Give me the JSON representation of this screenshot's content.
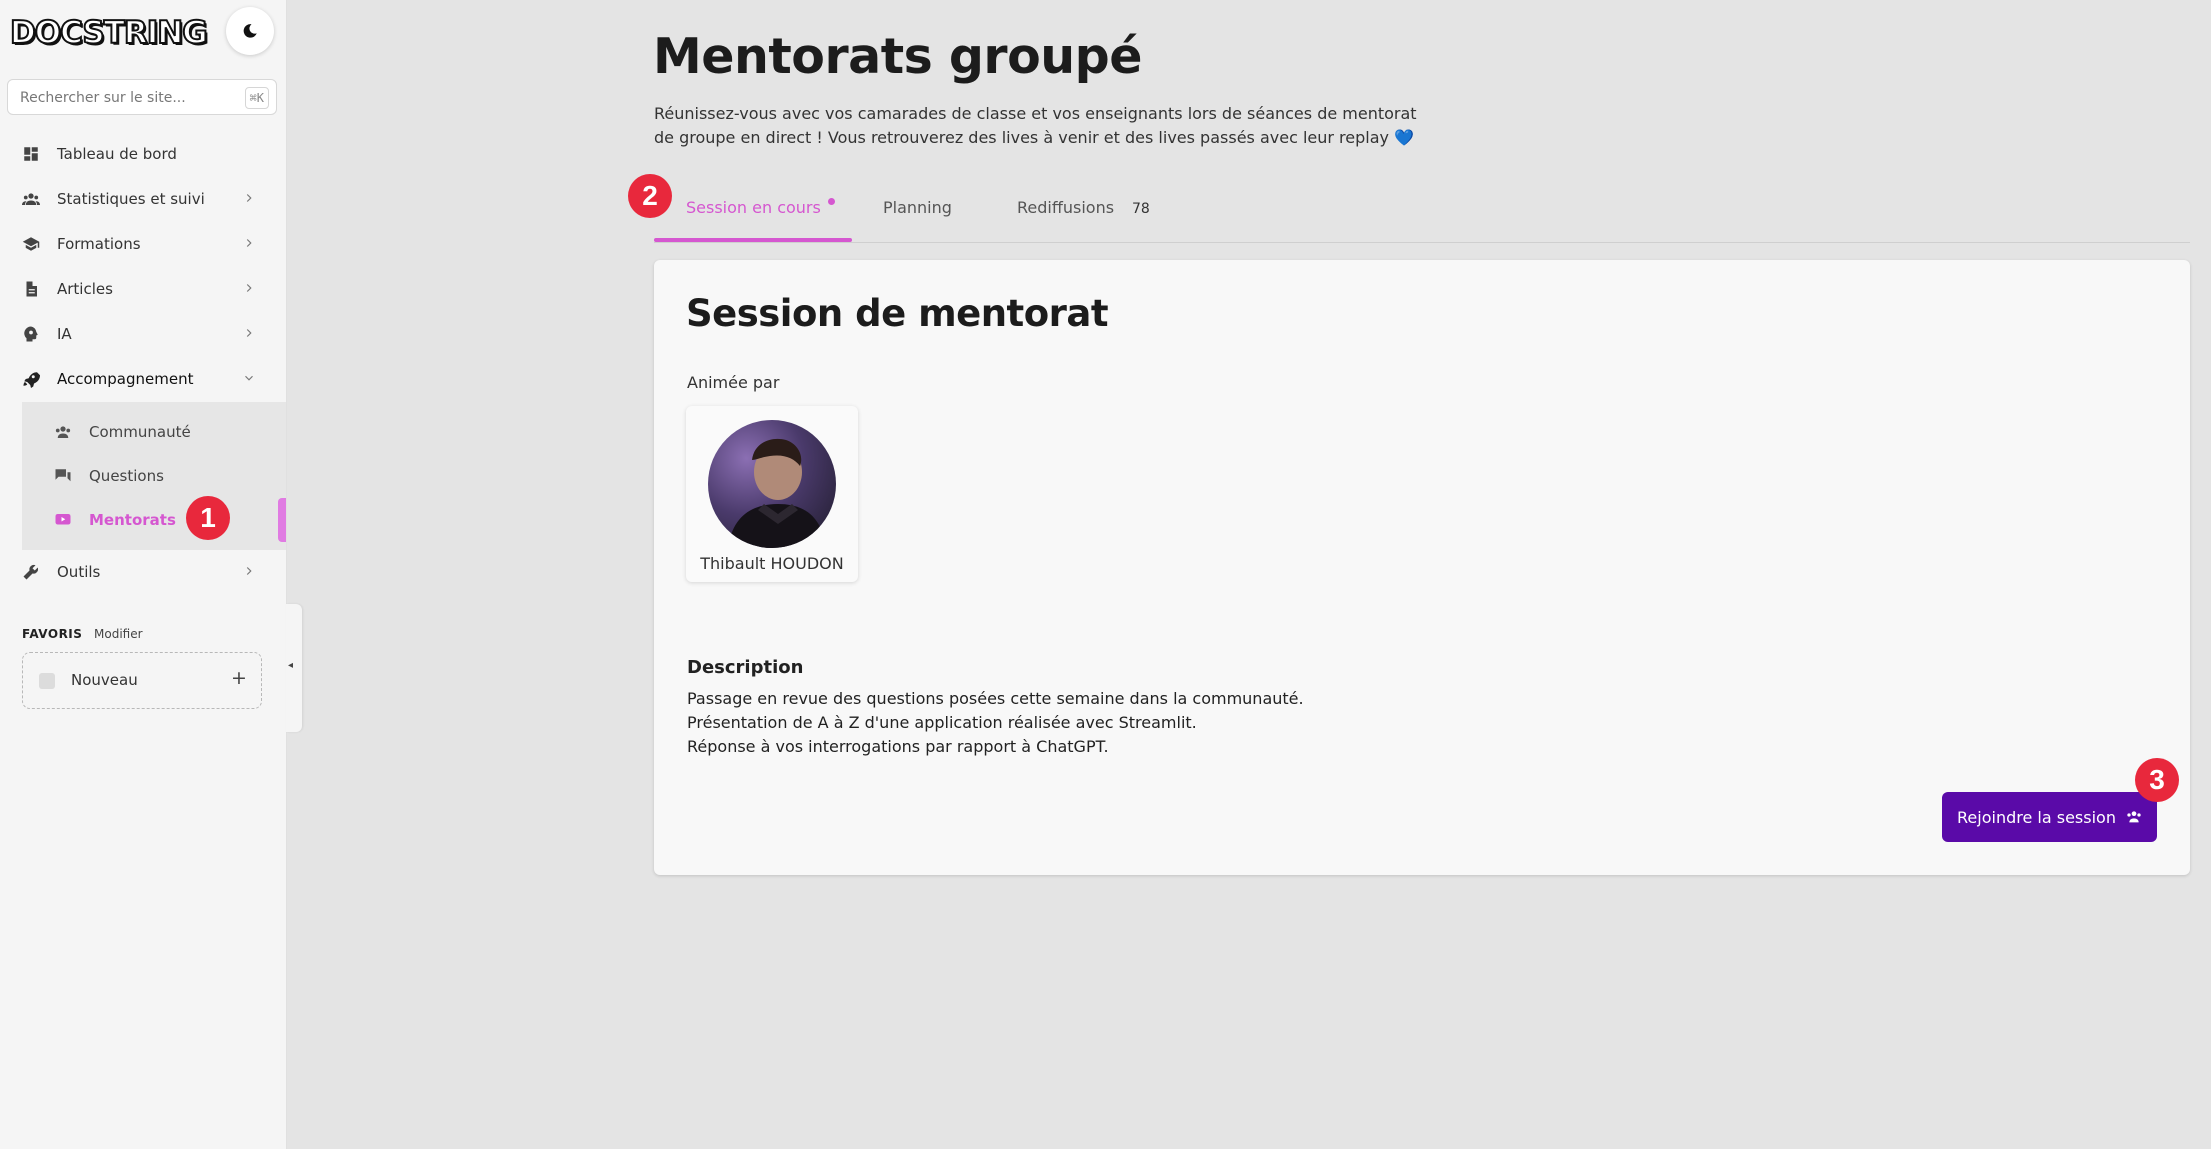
{
  "sidebar": {
    "logo": "DOCSTRING",
    "search_placeholder": "Rechercher sur le site...",
    "search_shortcut": "⌘K",
    "items": [
      {
        "label": "Tableau de bord",
        "icon": "dashboard-icon"
      },
      {
        "label": "Statistiques et suivi",
        "icon": "users-icon"
      },
      {
        "label": "Formations",
        "icon": "graduation-cap-icon"
      },
      {
        "label": "Articles",
        "icon": "document-icon"
      },
      {
        "label": "IA",
        "icon": "brain-icon"
      },
      {
        "label": "Accompagnement",
        "icon": "rocket-icon"
      },
      {
        "label": "Outils",
        "icon": "wrench-icon"
      }
    ],
    "subitems": [
      {
        "label": "Communauté",
        "icon": "community-icon"
      },
      {
        "label": "Questions",
        "icon": "chat-icon"
      },
      {
        "label": "Mentorats",
        "icon": "live-video-icon",
        "active": true
      }
    ],
    "favorites": {
      "title": "FAVORIS",
      "edit_label": "Modifier",
      "new_label": "Nouveau",
      "add_symbol": "+"
    },
    "collapse_symbol": "◂"
  },
  "annotations": {
    "one": "1",
    "two": "2",
    "three": "3"
  },
  "main": {
    "title": "Mentorats groupé",
    "description_line1": "Réunissez-vous avec vos camarades de classe et vos enseignants lors de séances de mentorat",
    "description_line2": "de groupe en direct ! Vous retrouverez des lives à venir et des lives passés avec leur replay",
    "description_emoji": "💙",
    "tabs": [
      {
        "label": "Session en cours",
        "active": true
      },
      {
        "label": "Planning"
      },
      {
        "label": "Rediffusions",
        "count": "78"
      }
    ],
    "session": {
      "title": "Session de mentorat",
      "hosted_by": "Animée par",
      "host_name": "Thibault HOUDON",
      "description_title": "Description",
      "description_lines": [
        "Passage en revue des questions posées cette semaine dans la communauté.",
        "Présentation de A à Z d'une application réalisée avec Streamlit.",
        "Réponse à vos interrogations par rapport à ChatGPT."
      ],
      "join_label": "Rejoindre la session"
    }
  },
  "colors": {
    "accent": "#d557d0",
    "button": "#5a0aa8",
    "annotation": "#e8283c"
  }
}
